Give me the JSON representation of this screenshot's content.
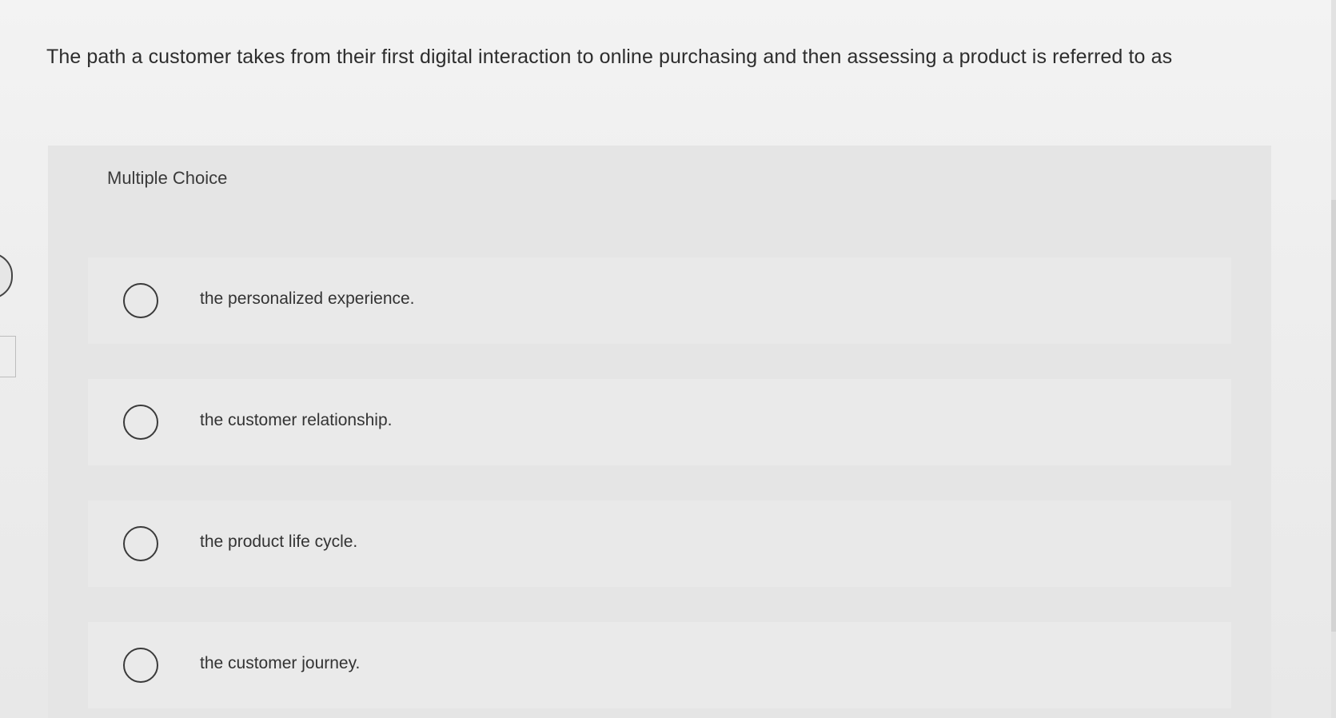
{
  "question": {
    "text": "The path a customer takes from their first digital interaction to online purchasing and then assessing a product is referred to as"
  },
  "choice_panel": {
    "label": "Multiple Choice",
    "options": [
      {
        "label": "the personalized experience."
      },
      {
        "label": "the customer relationship."
      },
      {
        "label": "the product life cycle."
      },
      {
        "label": "the customer journey."
      }
    ]
  }
}
